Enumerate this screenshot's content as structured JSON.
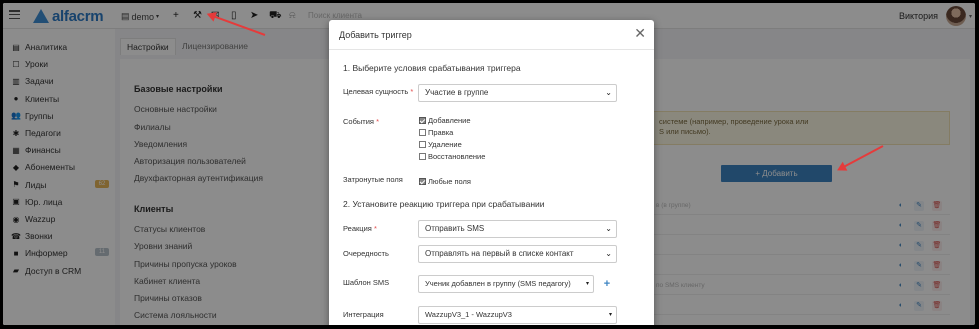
{
  "app": {
    "logo_text": "alfacrm",
    "branch": "demo",
    "search_placeholder": "Поиск клиента",
    "user_name": "Виктория"
  },
  "sidebar": {
    "items": [
      {
        "label": "Аналитика",
        "icon": "analytics-icon",
        "glyph": "▤"
      },
      {
        "label": "Уроки",
        "icon": "calendar-icon",
        "glyph": "☐"
      },
      {
        "label": "Задачи",
        "icon": "tasks-icon",
        "glyph": "▥"
      },
      {
        "label": "Клиенты",
        "icon": "user-icon",
        "glyph": "●"
      },
      {
        "label": "Группы",
        "icon": "group-icon",
        "glyph": "👥"
      },
      {
        "label": "Педагоги",
        "icon": "teacher-icon",
        "glyph": "✱"
      },
      {
        "label": "Финансы",
        "icon": "finance-icon",
        "glyph": "▦"
      },
      {
        "label": "Абонементы",
        "icon": "tag-icon",
        "glyph": "◆"
      },
      {
        "label": "Лиды",
        "icon": "leads-icon",
        "glyph": "⚑",
        "badge": "62",
        "badge_color": "#e8b75a"
      },
      {
        "label": "Юр. лица",
        "icon": "briefcase-icon",
        "glyph": "▣"
      },
      {
        "label": "Wazzup",
        "icon": "chat-icon",
        "glyph": "◉"
      },
      {
        "label": "Звонки",
        "icon": "phone-icon",
        "glyph": "☎"
      },
      {
        "label": "Информер",
        "icon": "informer-icon",
        "glyph": "■",
        "badge": "11",
        "badge_color": "#b8c4cc"
      },
      {
        "label": "Доступ в CRM",
        "icon": "access-icon",
        "glyph": "▰"
      }
    ]
  },
  "tabs": [
    {
      "label": "Настройки",
      "active": true
    },
    {
      "label": "Лицензирование",
      "active": false
    }
  ],
  "settings": {
    "basic_title": "Базовые настройки",
    "basic_links": [
      "Основные настройки",
      "Филиалы",
      "Уведомления",
      "Авторизация пользователей",
      "Двухфакторная аутентификация"
    ],
    "clients_title": "Клиенты",
    "client_links": [
      "Статусы клиентов",
      "Уровни знаний",
      "Причины пропуска уроков",
      "Кабинет клиента",
      "Причины отказов",
      "Система лояльности"
    ]
  },
  "background": {
    "info_text": "системе (например, проведение урока или\nS или письмо).",
    "add_button": "+ Добавить",
    "rows": [
      "в (в группе)",
      "",
      "",
      "",
      "по SMS клиенту",
      ""
    ]
  },
  "modal": {
    "title": "Добавить триггер",
    "step1": "1. Выберите условия срабатывания триггера",
    "entity_label": "Целевая сущность",
    "entity_value": "Участие в группе",
    "events_label": "События",
    "events": [
      {
        "label": "Добавление",
        "checked": true
      },
      {
        "label": "Правка",
        "checked": false
      },
      {
        "label": "Удаление",
        "checked": false
      },
      {
        "label": "Восстановление",
        "checked": false
      }
    ],
    "fields_label": "Затронутые поля",
    "fields_value": "Любые поля",
    "step2": "2. Установите реакцию триггера при срабатывании",
    "reaction_label": "Реакция",
    "reaction_value": "Отправить SMS",
    "order_label": "Очередность",
    "order_value": "Отправлять на первый в списке контакт",
    "template_label": "Шаблон SMS",
    "template_value": "Ученик добавлен в группу (SMS педагогу)",
    "integration_label": "Интеграция",
    "integration_value": "WazzupV3_1 - WazzupV3"
  },
  "colors": {
    "accent": "#3d84c2",
    "arrow": "#e53b3b",
    "required": "#e24b4b"
  }
}
